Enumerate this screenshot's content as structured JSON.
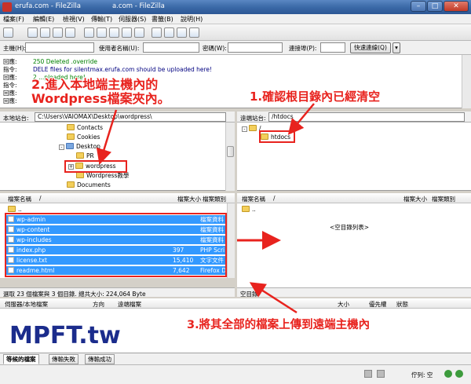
{
  "window": {
    "title": "erufa.com - FileZilla",
    "title_tail": "a.com - FileZilla",
    "minimize": "–",
    "maximize": "□",
    "close": "✕"
  },
  "menu": [
    "檔案(F)",
    "編輯(E)",
    "檢視(V)",
    "傳輸(T)",
    "伺服器(S)",
    "書籤(B)",
    "說明(H)"
  ],
  "quickconnect": {
    "host_label": "主機(H):",
    "user_label": "使用者名稱(U):",
    "pass_label": "密碼(W):",
    "port_label": "連接埠(P):",
    "connect_button": "快速連線(Q)",
    "dropdown": "▾"
  },
  "log": [
    {
      "key": "回應:",
      "text": "250 Deleted .override",
      "color": "g"
    },
    {
      "key": "指令:",
      "text": "DELE files for silentmax.erufa.com  should be uploaded here!",
      "color": "b"
    },
    {
      "key": "回應:",
      "text": "2                                    ...ploaded here!",
      "color": "g"
    },
    {
      "key": "指令:",
      "text": "",
      "color": "b"
    },
    {
      "key": "回應:",
      "text": "",
      "color": "g"
    },
    {
      "key": "回應:",
      "text": "",
      "color": "g"
    }
  ],
  "local": {
    "site_label": "本地站台:",
    "path": "C:\\Users\\VAIOMAX\\Desktop\\wordpress\\",
    "tree": [
      {
        "label": "Contacts",
        "indent": 0,
        "exp": ""
      },
      {
        "label": "Cookies",
        "indent": 0,
        "exp": ""
      },
      {
        "label": "Desktop",
        "indent": 0,
        "exp": "-"
      },
      {
        "label": "PR",
        "indent": 1,
        "exp": ""
      },
      {
        "label": "wordpress",
        "indent": 1,
        "exp": "+"
      },
      {
        "label": "Wordpress教學",
        "indent": 1,
        "exp": ""
      },
      {
        "label": "Documents",
        "indent": 0,
        "exp": ""
      }
    ],
    "columns": {
      "name": "檔案名稱",
      "sort": "/",
      "size": "檔案大小",
      "type": "檔案類別"
    },
    "files": [
      {
        "name": "..",
        "size": "",
        "type": "",
        "folder": true,
        "selected": false
      },
      {
        "name": "wp-admin",
        "size": "",
        "type": "檔案資料",
        "folder": true,
        "selected": true
      },
      {
        "name": "wp-content",
        "size": "",
        "type": "檔案資料",
        "folder": true,
        "selected": true
      },
      {
        "name": "wp-includes",
        "size": "",
        "type": "檔案資料",
        "folder": true,
        "selected": true
      },
      {
        "name": "index.php",
        "size": "397",
        "type": "PHP Scri",
        "folder": false,
        "selected": true
      },
      {
        "name": "license.txt",
        "size": "15,410",
        "type": "文字文件",
        "folder": false,
        "selected": true
      },
      {
        "name": "readme.html",
        "size": "7,642",
        "type": "Firefox D",
        "folder": false,
        "selected": true
      }
    ],
    "status": "選取 23 個檔案與 3 個目錄. 總共大小: 224,064 Byte"
  },
  "remote": {
    "site_label": "遠端站台:",
    "path": "/htdocs",
    "tree": [
      {
        "label": "/",
        "indent": 0
      },
      {
        "label": "htdocs",
        "indent": 1
      }
    ],
    "columns": {
      "name": "檔案名稱",
      "sort": "/",
      "size": "檔案大小",
      "type": "檔案類別"
    },
    "up_dir": "..",
    "empty_text": "<空目錄列表>",
    "status": "空目錄"
  },
  "queue": {
    "columns": [
      "伺服器/本地檔案",
      "方向",
      "遠端檔案",
      "大小",
      "優先權",
      "狀態"
    ],
    "tabs": [
      "等候的檔案",
      "傳輸失敗",
      "傳輸成功"
    ],
    "queue_status": "佇列: 空"
  },
  "annotations": {
    "step1": "1.確認根目錄內已經清空",
    "step2_line1": "2.進入本地端主機內的",
    "step2_line2": "Wordpress檔案夾內。",
    "step3": "3.將其全部的檔案上傳到遠端主機內",
    "watermark": "MPFT.tw"
  },
  "colors": {
    "annotation": "#e8231e",
    "selection": "#3399ff",
    "watermark": "#1b2c8c"
  }
}
